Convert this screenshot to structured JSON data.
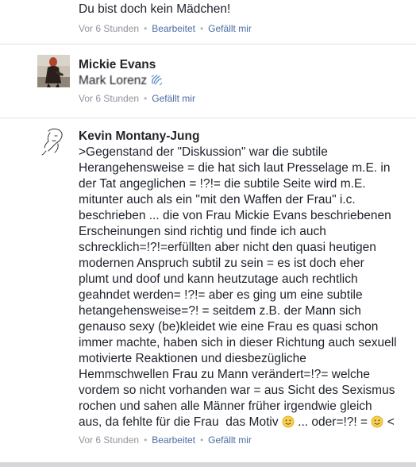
{
  "comments": [
    {
      "text": "Du bist doch kein Mädchen!",
      "meta": {
        "time": "Vor 6 Stunden",
        "edited": "Bearbeitet",
        "like": "Gefällt mir"
      }
    },
    {
      "author": "Mickie Evans",
      "mention": "Mark Lorenz",
      "meta": {
        "time": "Vor 6 Stunden",
        "like": "Gefällt mir"
      }
    },
    {
      "author": "Kevin Montany-Jung",
      "text_lines": [
        ">Gegenstand der \"Diskussion\" war die subtile",
        "Herangehensweise = die hat sich laut Presselage m.E.  in",
        "der Tat angeglichen = !?!= die subtile Seite wird m.E.",
        "mitunter auch als ein \"mit den Waffen der Frau\" i.c.",
        "beschrieben ... die von Frau Mickie Evans beschriebenen",
        "Erscheinungen sind richtig und finde ich auch",
        "schrecklich=!?!=erfüllten  aber  nicht den quasi heutigen",
        "modernen Anspruch subtil zu sein = es ist doch eher",
        "plumt und doof und kann heutzutage auch rechtlich",
        "geahndet werden= !?!= aber es ging um eine subtile",
        "hetangehensweise=?! = seitdem z.B. der Mann sich",
        "genauso sexy (be)kleidet wie eine Frau es quasi schon",
        "immer machte, haben sich in dieser Richtung auch sexuell",
        "motivierte Reaktionen und diesbezügliche",
        "Hemmschwellen Frau zu Mann verändert=!?= welche",
        "vordem so nicht vorhanden war = aus Sicht des Sexismus",
        "rochen und sahen  alle Männer früher irgendwie gleich"
      ],
      "last_line": {
        "a": "aus, da fehlte für die Frau  das Motiv ",
        "b": " ... oder=!?! = ",
        "c": " <"
      },
      "meta": {
        "time": "Vor 6 Stunden",
        "edited": "Bearbeitet",
        "like": "Gefällt mir"
      }
    }
  ],
  "icons": {
    "wave": "waving-hand-icon",
    "smile": "smiley-icon"
  },
  "colors": {
    "link": "#4b6aa3",
    "meta": "#90949c",
    "divider": "#e1e2e4"
  }
}
